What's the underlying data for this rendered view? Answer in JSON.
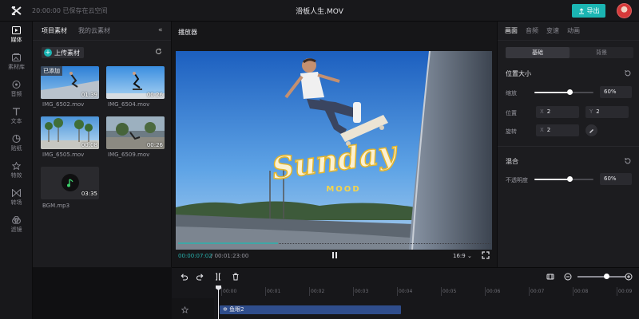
{
  "topbar": {
    "save_status": "20:00:00 已保存在云空间",
    "title": "滑板人生.MOV",
    "export_label": "导出"
  },
  "rail": {
    "items": [
      {
        "label": "媒体",
        "icon": "media-icon",
        "active": true
      },
      {
        "label": "素材库",
        "icon": "library-icon",
        "active": false
      },
      {
        "label": "音频",
        "icon": "audio-icon",
        "active": false
      },
      {
        "label": "文本",
        "icon": "text-icon",
        "active": false
      },
      {
        "label": "贴纸",
        "icon": "sticker-icon",
        "active": false
      },
      {
        "label": "特效",
        "icon": "effects-icon",
        "active": false
      },
      {
        "label": "转场",
        "icon": "transition-icon",
        "active": false
      },
      {
        "label": "滤镜",
        "icon": "filter-icon",
        "active": false
      }
    ]
  },
  "media": {
    "tabs": [
      "项目素材",
      "我的云素材"
    ],
    "upload_label": "上传素材",
    "added_badge": "已添加",
    "items": [
      {
        "name": "IMG_6502.mov",
        "duration": "01:39"
      },
      {
        "name": "IMG_6504.mov",
        "duration": "00:26"
      },
      {
        "name": "IMG_6505.mov",
        "duration": "00:08"
      },
      {
        "name": "IMG_6509.mov",
        "duration": "00:26"
      },
      {
        "name": "BGM.mp3",
        "duration": "03:35"
      }
    ]
  },
  "player": {
    "title": "播放器",
    "overlay_main": "Sunday",
    "overlay_sub": "MOOD",
    "current_time": "00:00:07:02",
    "total_time": "/ 00:01:23:00",
    "ratio": "16:9",
    "progress": 0.32
  },
  "props": {
    "tabs": [
      "画面",
      "音频",
      "变速",
      "动画"
    ],
    "segments": [
      "基础",
      "背景"
    ],
    "position_section": "位置大小",
    "scale_label": "缩放",
    "scale_value": "60%",
    "scale_level": 0.6,
    "position_label": "位置",
    "pos_x_axis": "X",
    "pos_x": "2",
    "pos_y_axis": "Y",
    "pos_y": "2",
    "rotate_label": "旋转",
    "rot_axis": "X",
    "rotate_value": "2",
    "blend_section": "混合",
    "opacity_label": "不透明度",
    "opacity_value": "60%",
    "opacity_level": 0.6
  },
  "timeline": {
    "ticks": [
      "00:00",
      "00:01",
      "00:02",
      "00:03",
      "00:04",
      "00:05",
      "00:06",
      "00:07",
      "00:08",
      "00:09"
    ],
    "clip_label": "鱼眼2",
    "zoom_level": 0.6
  }
}
